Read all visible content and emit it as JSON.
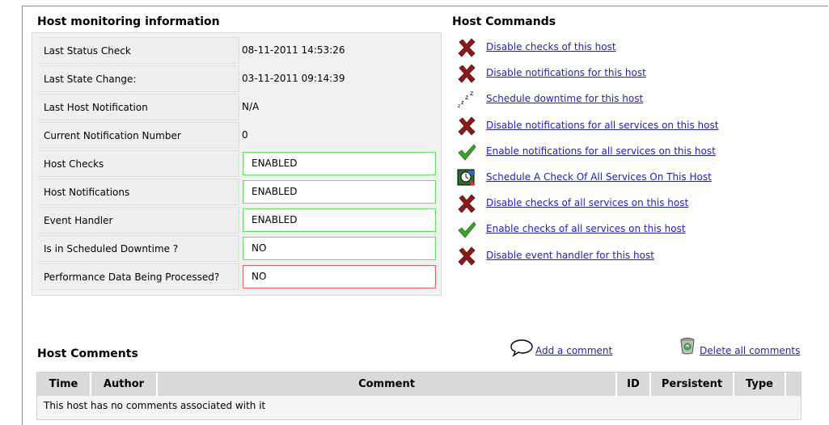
{
  "monitoring": {
    "title": "Host monitoring information",
    "rows": [
      {
        "label": "Last Status Check",
        "value": "08-11-2011 14:53:26",
        "style": "plain"
      },
      {
        "label": "Last State Change:",
        "value": "03-11-2011 09:14:39",
        "style": "plain"
      },
      {
        "label": "Last Host Notification",
        "value": "N/A",
        "style": "plain"
      },
      {
        "label": "Current Notification Number",
        "value": "0",
        "style": "plain"
      },
      {
        "label": "Host Checks",
        "value": "ENABLED",
        "style": "ok"
      },
      {
        "label": "Host Notifications",
        "value": "ENABLED",
        "style": "ok"
      },
      {
        "label": "Event Handler",
        "value": "ENABLED",
        "style": "ok"
      },
      {
        "label": "Is in Scheduled Downtime ?",
        "value": "NO",
        "style": "ok"
      },
      {
        "label": "Performance Data Being Processed?",
        "value": "NO",
        "style": "bad"
      }
    ]
  },
  "commands": {
    "title": "Host Commands",
    "items": [
      {
        "label": "Disable checks of this host",
        "icon": "red-x-icon"
      },
      {
        "label": "Disable notifications for this host",
        "icon": "red-x-icon"
      },
      {
        "label": "Schedule downtime for this host",
        "icon": "sleep-zzz-icon"
      },
      {
        "label": "Disable notifications for all services on this host",
        "icon": "red-x-icon"
      },
      {
        "label": "Enable notifications for all services on this host",
        "icon": "green-check-icon"
      },
      {
        "label": "Schedule A Check Of All Services On This Host",
        "icon": "schedule-check-icon"
      },
      {
        "label": "Disable checks of all services on this host",
        "icon": "red-x-icon"
      },
      {
        "label": "Enable checks of all services on this host",
        "icon": "green-check-icon"
      },
      {
        "label": "Disable event handler for this host",
        "icon": "red-x-icon"
      }
    ]
  },
  "comments": {
    "title": "Host Comments",
    "add_label": "Add a comment",
    "delete_label": "Delete all comments",
    "columns": [
      "Time",
      "Author",
      "Comment",
      "ID",
      "Persistent",
      "Type"
    ],
    "empty_message": "This host has no comments associated with it"
  },
  "colors": {
    "link": "#1f1fbf",
    "ok_border": "#5fe05f",
    "bad_border": "#e06060",
    "red_x": "#8b1a1a",
    "green_check": "#3aa52a"
  }
}
